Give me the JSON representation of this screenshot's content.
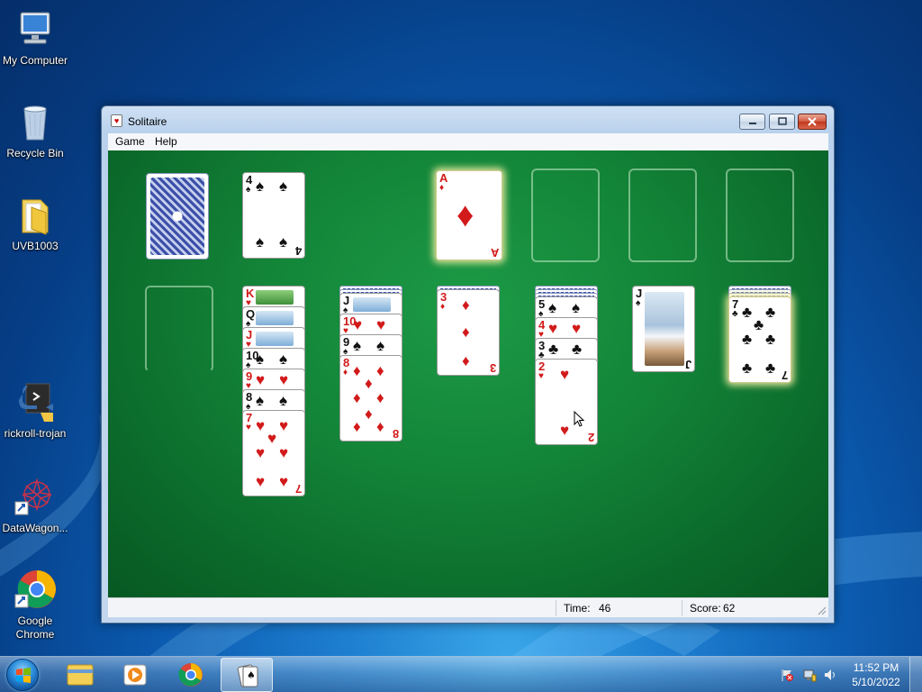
{
  "desktop": {
    "icons": [
      {
        "label": "My Computer",
        "icon": "computer-icon"
      },
      {
        "label": "Recycle Bin",
        "icon": "recycle-bin-icon"
      },
      {
        "label": "UVB1003",
        "icon": "folder-icon"
      },
      {
        "label": "rickroll-trojan",
        "icon": "python-icon"
      },
      {
        "label": "DataWagon...",
        "icon": "datawagon-icon"
      },
      {
        "label": "Google Chrome",
        "icon": "chrome-icon"
      }
    ]
  },
  "window": {
    "title": "Solitaire",
    "menu": [
      "Game",
      "Help"
    ],
    "status": {
      "time_label": "Time:",
      "time_value": "46",
      "score_label": "Score:",
      "score_value": "62"
    }
  },
  "game": {
    "waste_top": {
      "rank": "4",
      "suit": "♠",
      "color": "black"
    },
    "foundations": [
      {
        "rank": "A",
        "suit": "♦",
        "color": "red"
      },
      null,
      null,
      null
    ],
    "tableau": [
      {
        "face_down": 0,
        "cards": []
      },
      {
        "face_down": 0,
        "cards": [
          {
            "rank": "K",
            "suit": "♥",
            "color": "red"
          },
          {
            "rank": "Q",
            "suit": "♠",
            "color": "black"
          },
          {
            "rank": "J",
            "suit": "♥",
            "color": "red"
          },
          {
            "rank": "10",
            "suit": "♠",
            "color": "black"
          },
          {
            "rank": "9",
            "suit": "♥",
            "color": "red"
          },
          {
            "rank": "8",
            "suit": "♠",
            "color": "black"
          },
          {
            "rank": "7",
            "suit": "♥",
            "color": "red"
          }
        ]
      },
      {
        "face_down": 2,
        "cards": [
          {
            "rank": "J",
            "suit": "♠",
            "color": "black"
          },
          {
            "rank": "10",
            "suit": "♥",
            "color": "red"
          },
          {
            "rank": "9",
            "suit": "♠",
            "color": "black"
          },
          {
            "rank": "8",
            "suit": "♦",
            "color": "red"
          }
        ]
      },
      {
        "face_down": 1,
        "cards": [
          {
            "rank": "3",
            "suit": "♦",
            "color": "red"
          }
        ]
      },
      {
        "face_down": 3,
        "cards": [
          {
            "rank": "5",
            "suit": "♠",
            "color": "black"
          },
          {
            "rank": "4",
            "suit": "♥",
            "color": "red"
          },
          {
            "rank": "3",
            "suit": "♣",
            "color": "black"
          },
          {
            "rank": "2",
            "suit": "♥",
            "color": "red"
          }
        ]
      },
      {
        "face_down": 0,
        "cards": [
          {
            "rank": "J",
            "suit": "♠",
            "color": "black"
          }
        ]
      },
      {
        "face_down": 3,
        "cards": [
          {
            "rank": "7",
            "suit": "♣",
            "color": "black"
          }
        ],
        "highlighted": true
      }
    ]
  },
  "taskbar": {
    "pinned": [
      "explorer-icon",
      "media-player-icon",
      "chrome-icon",
      "solitaire-icon"
    ],
    "active": "solitaire-icon",
    "clock_time": "11:52 PM",
    "clock_date": "5/10/2022"
  },
  "colors": {
    "felt": "#138538",
    "red_suit": "#d21a1a",
    "black_suit": "#111111",
    "titlebar": "#c3d6ee"
  }
}
